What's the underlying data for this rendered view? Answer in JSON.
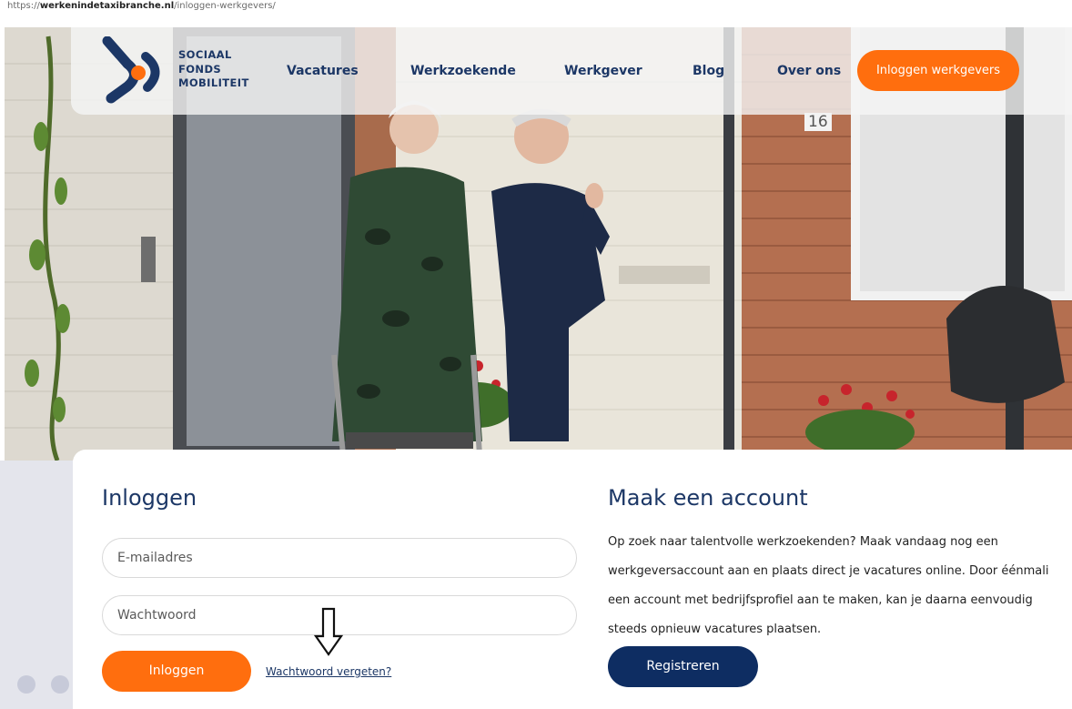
{
  "address_bar": {
    "prefix": "https://",
    "domain": "werkenindetaxibranche.nl",
    "path": "/inloggen-werkgevers/"
  },
  "header": {
    "logo_lines": [
      "SOCIAAL",
      "FONDS",
      "MOBILITEIT"
    ],
    "nav": [
      "Vacatures",
      "Werkzoekende",
      "Werkgever",
      "Blog",
      "Over ons"
    ],
    "cta_label": "Inloggen werkgevers"
  },
  "hero": {
    "house_number": "16"
  },
  "login": {
    "title": "Inloggen",
    "email_placeholder": "E-mailadres",
    "password_placeholder": "Wachtwoord",
    "submit_label": "Inloggen",
    "forgot_label": "Wachtwoord vergeten?"
  },
  "register": {
    "title": "Maak een account",
    "lines": [
      "Op zoek naar talentvolle werkzoekenden? Maak vandaag nog een",
      "werkgeversaccount aan en plaats direct je vacatures online. Door éénmali",
      "een account met bedrijfsprofiel aan te maken, kan je daarna eenvoudig",
      "steeds opnieuw vacatures plaatsen."
    ],
    "button_label": "Registreren"
  },
  "colors": {
    "brand_navy": "#1c3766",
    "accent_orange": "#ff6e0e",
    "button_navy": "#0e2d62"
  }
}
